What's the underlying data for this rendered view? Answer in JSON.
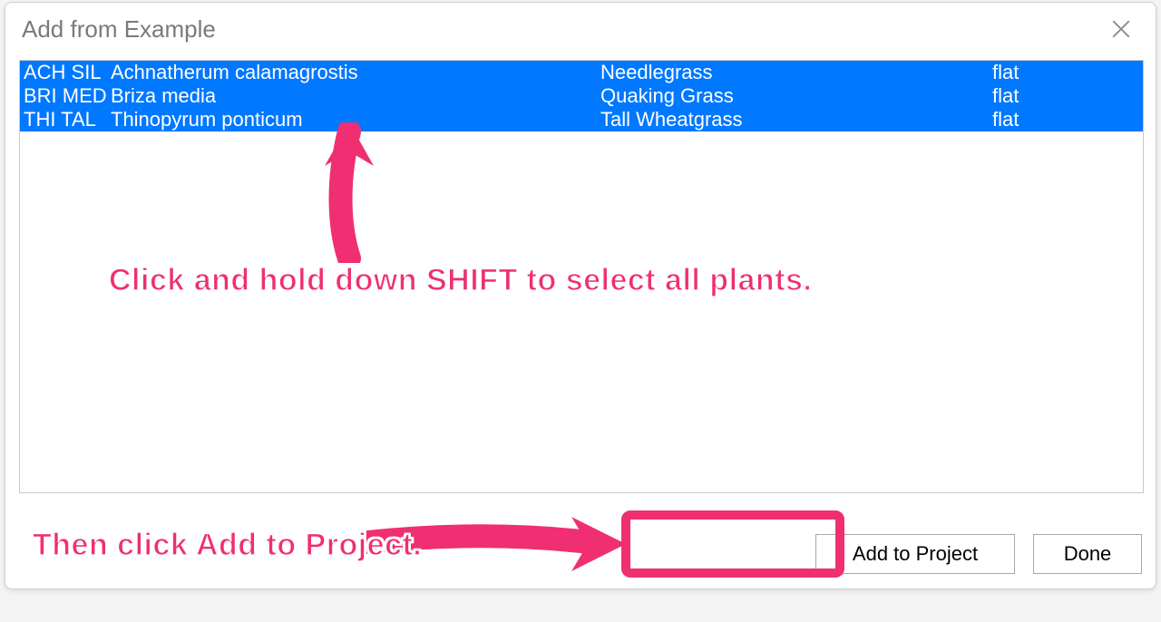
{
  "dialog": {
    "title": "Add from Example",
    "close_icon": "close"
  },
  "plants": [
    {
      "code": "ACH SIL",
      "latin": "Achnatherum calamagrostis",
      "common": "Needlegrass",
      "type": "flat"
    },
    {
      "code": "BRI MED",
      "latin": "Briza media",
      "common": "Quaking Grass",
      "type": "flat"
    },
    {
      "code": "THI TAL",
      "latin": "Thinopyrum  ponticum",
      "common": "Tall Wheatgrass",
      "type": "flat"
    }
  ],
  "buttons": {
    "add": "Add to Project",
    "done": "Done"
  },
  "annotations": {
    "shift_select": "Click and hold down SHIFT to select all plants.",
    "then_add": "Then click Add to Project."
  },
  "colors": {
    "selection": "#0078ff",
    "accent": "#ef2f72"
  }
}
